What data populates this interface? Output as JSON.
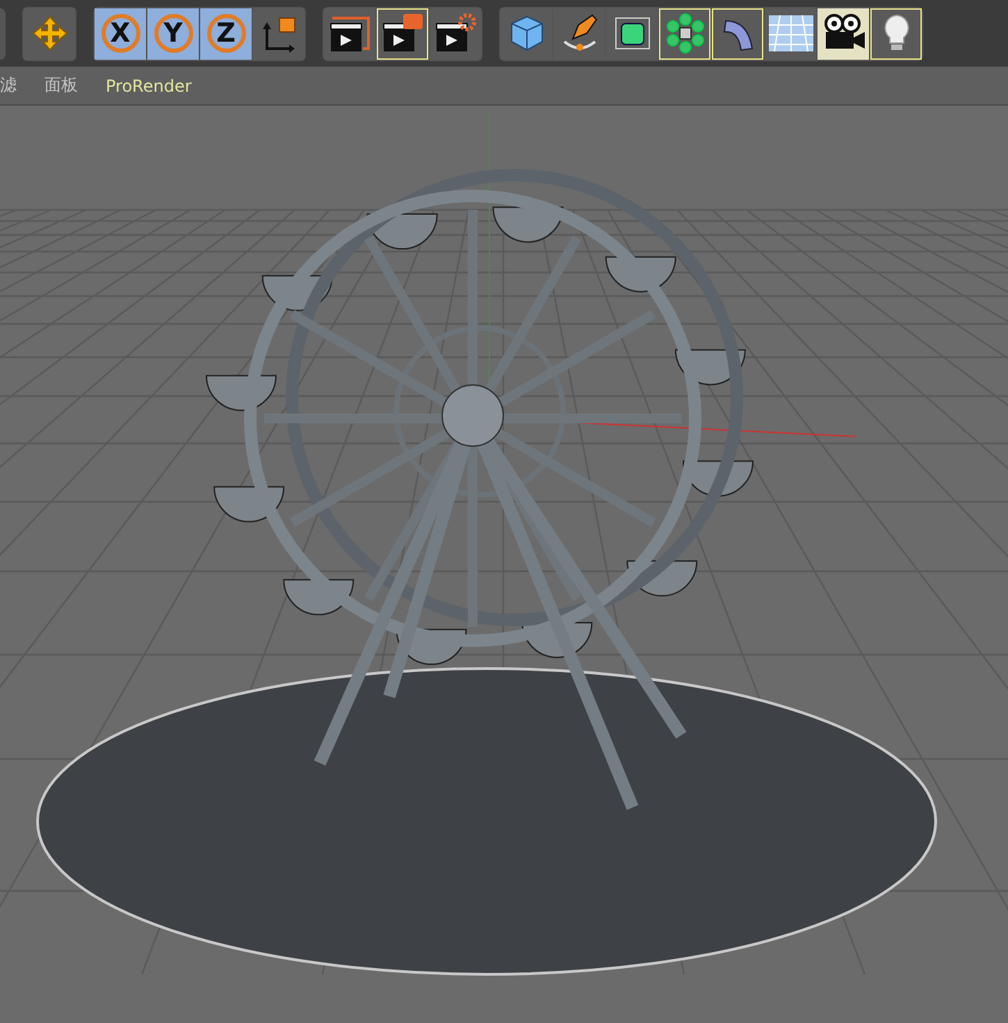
{
  "toolbar": {
    "groups": [
      {
        "tools": [
          {
            "kind": "move",
            "selected": false,
            "highlighted": false
          }
        ]
      },
      {
        "tools": [
          {
            "kind": "axis",
            "label": "X",
            "selected": true,
            "highlighted": false
          },
          {
            "kind": "axis",
            "label": "Y",
            "selected": true,
            "highlighted": false
          },
          {
            "kind": "axis",
            "label": "Z",
            "selected": true,
            "highlighted": false
          },
          {
            "kind": "coords",
            "selected": false,
            "highlighted": false
          }
        ]
      },
      {
        "tools": [
          {
            "kind": "render-view",
            "selected": false,
            "highlighted": false
          },
          {
            "kind": "render-picture",
            "selected": false,
            "highlighted": true
          },
          {
            "kind": "render-settings",
            "selected": false,
            "highlighted": false
          }
        ]
      },
      {
        "tools": [
          {
            "kind": "cube",
            "selected": false,
            "highlighted": false
          },
          {
            "kind": "pen",
            "selected": false,
            "highlighted": false
          },
          {
            "kind": "subdivision",
            "selected": false,
            "highlighted": false
          },
          {
            "kind": "cloner",
            "selected": false,
            "highlighted": true
          },
          {
            "kind": "bend",
            "selected": false,
            "highlighted": true
          },
          {
            "kind": "floor",
            "selected": false,
            "highlighted": false
          },
          {
            "kind": "camera",
            "selected": true,
            "highlighted": false
          },
          {
            "kind": "light",
            "selected": false,
            "highlighted": true
          }
        ]
      }
    ]
  },
  "menu": {
    "items": [
      {
        "label": "滤"
      },
      {
        "label": "面板"
      },
      {
        "label": "ProRender",
        "accent": true
      }
    ]
  }
}
